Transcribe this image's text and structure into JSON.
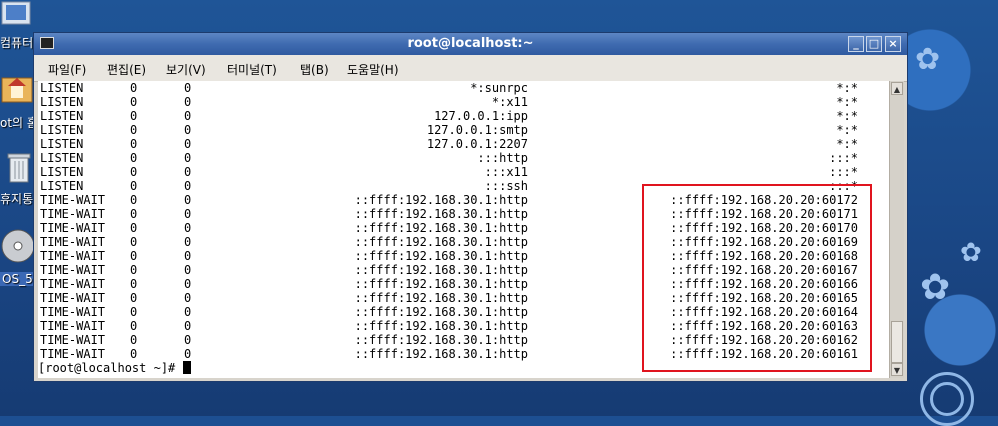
{
  "window": {
    "title": "root@localhost:~",
    "buttons": {
      "minimize": "_",
      "maximize": "□",
      "close": "×"
    }
  },
  "menu": [
    "파일(F)",
    "편집(E)",
    "보기(V)",
    "터미널(T)",
    "탭(B)",
    "도움말(H)"
  ],
  "desktop": {
    "icons": [
      {
        "name": "computer-icon",
        "label": "컴퓨터"
      },
      {
        "name": "home-folder-icon",
        "label": "ot의 홈"
      },
      {
        "name": "trash-icon",
        "label": "휴지통"
      },
      {
        "name": "dvd-icon",
        "label": "OS_5"
      }
    ]
  },
  "terminal": {
    "rows": [
      {
        "state": "LISTEN",
        "recvq": "0",
        "sendq": "0",
        "local": "*:sunrpc",
        "foreign": "*:*"
      },
      {
        "state": "LISTEN",
        "recvq": "0",
        "sendq": "0",
        "local": "*:x11",
        "foreign": "*:*"
      },
      {
        "state": "LISTEN",
        "recvq": "0",
        "sendq": "0",
        "local": "127.0.0.1:ipp",
        "foreign": "*:*"
      },
      {
        "state": "LISTEN",
        "recvq": "0",
        "sendq": "0",
        "local": "127.0.0.1:smtp",
        "foreign": "*:*"
      },
      {
        "state": "LISTEN",
        "recvq": "0",
        "sendq": "0",
        "local": "127.0.0.1:2207",
        "foreign": "*:*"
      },
      {
        "state": "LISTEN",
        "recvq": "0",
        "sendq": "0",
        "local": ":::http",
        "foreign": ":::*"
      },
      {
        "state": "LISTEN",
        "recvq": "0",
        "sendq": "0",
        "local": ":::x11",
        "foreign": ":::*"
      },
      {
        "state": "LISTEN",
        "recvq": "0",
        "sendq": "0",
        "local": ":::ssh",
        "foreign": ":::*"
      },
      {
        "state": "TIME-WAIT",
        "recvq": "0",
        "sendq": "0",
        "local": "::ffff:192.168.30.1:http",
        "foreign": "::ffff:192.168.20.20:60172"
      },
      {
        "state": "TIME-WAIT",
        "recvq": "0",
        "sendq": "0",
        "local": "::ffff:192.168.30.1:http",
        "foreign": "::ffff:192.168.20.20:60171"
      },
      {
        "state": "TIME-WAIT",
        "recvq": "0",
        "sendq": "0",
        "local": "::ffff:192.168.30.1:http",
        "foreign": "::ffff:192.168.20.20:60170"
      },
      {
        "state": "TIME-WAIT",
        "recvq": "0",
        "sendq": "0",
        "local": "::ffff:192.168.30.1:http",
        "foreign": "::ffff:192.168.20.20:60169"
      },
      {
        "state": "TIME-WAIT",
        "recvq": "0",
        "sendq": "0",
        "local": "::ffff:192.168.30.1:http",
        "foreign": "::ffff:192.168.20.20:60168"
      },
      {
        "state": "TIME-WAIT",
        "recvq": "0",
        "sendq": "0",
        "local": "::ffff:192.168.30.1:http",
        "foreign": "::ffff:192.168.20.20:60167"
      },
      {
        "state": "TIME-WAIT",
        "recvq": "0",
        "sendq": "0",
        "local": "::ffff:192.168.30.1:http",
        "foreign": "::ffff:192.168.20.20:60166"
      },
      {
        "state": "TIME-WAIT",
        "recvq": "0",
        "sendq": "0",
        "local": "::ffff:192.168.30.1:http",
        "foreign": "::ffff:192.168.20.20:60165"
      },
      {
        "state": "TIME-WAIT",
        "recvq": "0",
        "sendq": "0",
        "local": "::ffff:192.168.30.1:http",
        "foreign": "::ffff:192.168.20.20:60164"
      },
      {
        "state": "TIME-WAIT",
        "recvq": "0",
        "sendq": "0",
        "local": "::ffff:192.168.30.1:http",
        "foreign": "::ffff:192.168.20.20:60163"
      },
      {
        "state": "TIME-WAIT",
        "recvq": "0",
        "sendq": "0",
        "local": "::ffff:192.168.30.1:http",
        "foreign": "::ffff:192.168.20.20:60162"
      },
      {
        "state": "TIME-WAIT",
        "recvq": "0",
        "sendq": "0",
        "local": "::ffff:192.168.30.1:http",
        "foreign": "::ffff:192.168.20.20:60161"
      }
    ],
    "prompt": "[root@localhost ~]# "
  },
  "colors": {
    "highlight": "#e0141e",
    "titlebar": "#3f6bb0",
    "desktop": "#1d4f92"
  }
}
